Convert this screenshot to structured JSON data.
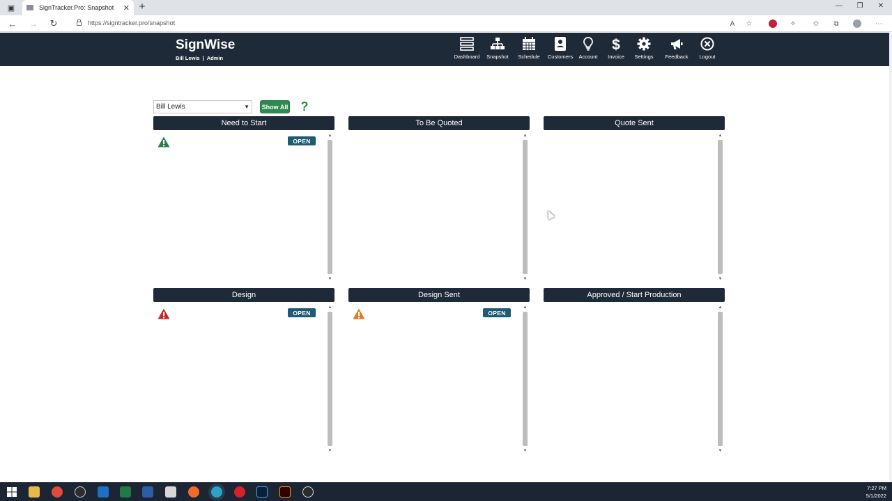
{
  "browser": {
    "tab_title": "SignTracker.Pro: Snapshot",
    "url": "https://signtracker.pro/snapshot"
  },
  "app": {
    "brand": "SignWise",
    "user_name": "Bill Lewis",
    "separator": "|",
    "role": "Admin"
  },
  "nav": {
    "items": [
      {
        "label": "Dashboard",
        "icon": "dashboard-icon"
      },
      {
        "label": "Snapshot",
        "icon": "sitemap-icon"
      },
      {
        "label": "Schedule",
        "icon": "calendar-icon"
      },
      {
        "label": "Customers",
        "icon": "address-book-icon"
      },
      {
        "label": "Account",
        "icon": "lightbulb-icon"
      },
      {
        "label": "Invoice",
        "icon": "dollar-icon"
      },
      {
        "label": "Settings",
        "icon": "gear-icon"
      },
      {
        "label": "Feedback",
        "icon": "megaphone-icon"
      },
      {
        "label": "Logout",
        "icon": "logout-icon"
      }
    ]
  },
  "controls": {
    "user_select_value": "Bill Lewis",
    "show_all_label": "Show All",
    "help_glyph": "?"
  },
  "columns": [
    {
      "title": "Need to Start",
      "cards": [
        {
          "warning": "green",
          "badge": "OPEN"
        }
      ]
    },
    {
      "title": "To Be Quoted",
      "cards": []
    },
    {
      "title": "Quote Sent",
      "cards": []
    },
    {
      "title": "Design",
      "cards": [
        {
          "warning": "red",
          "badge": "OPEN"
        }
      ]
    },
    {
      "title": "Design Sent",
      "cards": [
        {
          "warning": "orange",
          "badge": "OPEN"
        }
      ]
    },
    {
      "title": "Approved / Start Production",
      "cards": []
    }
  ],
  "colors": {
    "header_bg": "#1f2a38",
    "badge_bg": "#1d5c73",
    "show_all_bg": "#2f8a4d",
    "warning_green": "#2f7d4a",
    "warning_red": "#c62828",
    "warning_orange": "#e07b24"
  },
  "taskbar": {
    "time": "7:27 PM",
    "date": "5/1/2022"
  }
}
